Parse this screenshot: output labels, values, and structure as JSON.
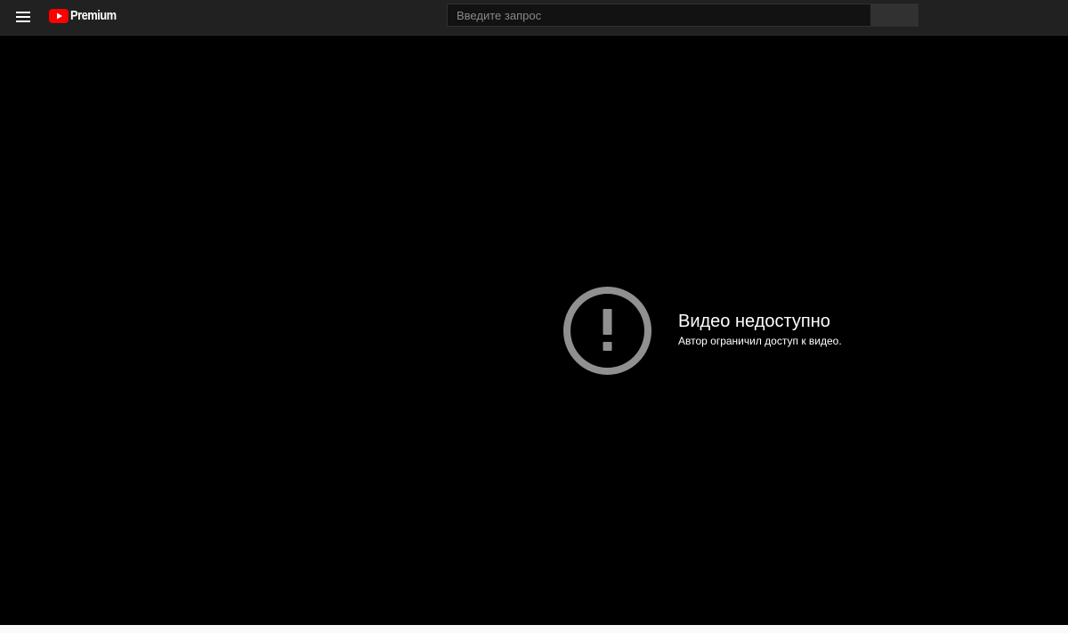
{
  "header": {
    "logo_text": "Premium",
    "search": {
      "placeholder": "Введите запрос",
      "value": ""
    }
  },
  "player": {
    "error_title": "Видео недоступно",
    "error_subtitle": "Автор ограничил доступ к видео."
  },
  "icons": {
    "menu": "hamburger-menu-icon",
    "logo": "youtube-logo-icon",
    "error": "exclamation-circle-icon"
  },
  "colors": {
    "masthead": "#212121",
    "brand_red": "#ff0000",
    "background": "#000000",
    "error_icon": "#909090",
    "text": "#ffffff"
  }
}
